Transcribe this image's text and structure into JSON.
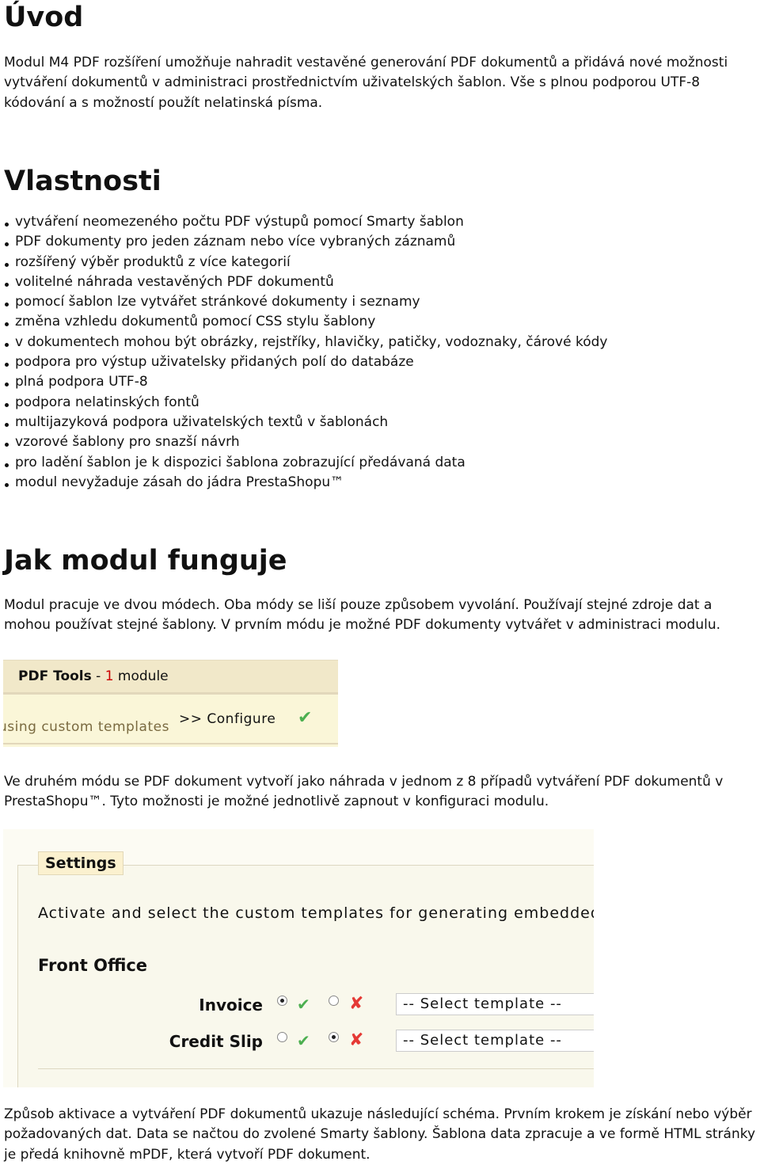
{
  "intro": {
    "title": "Úvod",
    "text": "Modul M4 PDF rozšíření umožňuje nahradit vestavěné generování PDF dokumentů a přidává nové možnosti vytváření dokumentů v administraci prostřednictvím uživatelských šablon. Vše s plnou podporou UTF-8 kódování a s možností použít nelatinská písma."
  },
  "features": {
    "title": "Vlastnosti",
    "items": [
      "vytváření neomezeného počtu PDF výstupů pomocí Smarty šablon",
      "PDF dokumenty pro jeden záznam nebo více vybraných záznamů",
      "rozšířený výběr produktů z více kategorií",
      "volitelné náhrada vestavěných PDF dokumentů",
      "pomocí šablon lze vytvářet stránkové dokumenty i seznamy",
      "změna vzhledu dokumentů pomocí CSS stylu šablony",
      "v dokumentech mohou být obrázky, rejstříky, hlavičky, patičky, vodoznaky, čárové kódy",
      "podpora pro výstup uživatelsky přidaných polí do databáze",
      "plná podpora UTF-8",
      "podpora nelatinských fontů",
      "multijazyková podpora uživatelských textů v šablonách",
      "vzorové šablony pro snazší návrh",
      "pro ladění šablon je k dispozici šablona zobrazující předávaná data",
      "modul nevyžaduje zásah do jádra PrestaShopu™"
    ]
  },
  "how": {
    "title": "Jak modul funguje",
    "text1": "Modul pracuje ve dvou módech. Oba módy se liší pouze způsobem vyvolání. Používají stejné zdroje dat a mohou používat stejné šablony. V prvním módu je možné PDF dokumenty vytvářet v administraci modulu.",
    "text2": "Ve druhém módu se PDF dokument vytvoří jako náhrada v jednom z 8 případů vytváření PDF dokumentů v PrestaShopu™. Tyto možnosti je možné jednotlivě zapnout v konfiguraci modulu.",
    "text3": "Způsob aktivace a vytváření PDF dokumentů ukazuje následující schéma. Prvním krokem je získání nebo výběr požadovaných dat. Data se načtou do zvolené Smarty šablony. Šablona data zpracuje a ve formě HTML stránky je předá knihovně mPDF, která vytvoří PDF dokument."
  },
  "screenshot1": {
    "category": "PDF Tools",
    "sep": " - ",
    "count": "1",
    "unit": " module",
    "description": "using custom templates",
    "configure": ">> Configure"
  },
  "screenshot2": {
    "legend": "Settings",
    "description": "Activate and select the custom templates for generating embedded",
    "section": "Front Office",
    "rows": [
      {
        "label": "Invoice",
        "enabled": true,
        "select": "-- Select template --"
      },
      {
        "label": "Credit Slip",
        "enabled": false,
        "select": "-- Select template --"
      }
    ]
  }
}
